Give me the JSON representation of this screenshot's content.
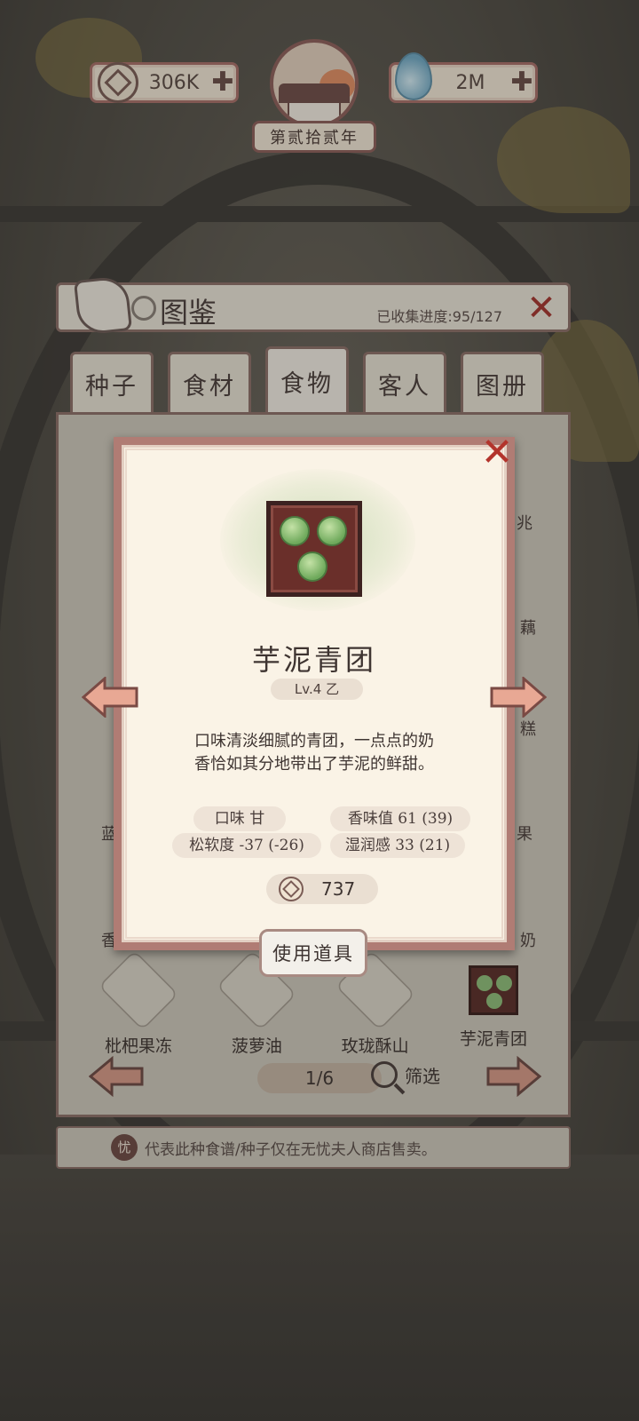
{
  "topbar": {
    "coins": "306K",
    "essence": "2M",
    "plus_symbol": "✚",
    "year_label": "第贰拾贰年"
  },
  "encyclopedia": {
    "title": "图鉴",
    "progress_label": "已收集进度:95/127",
    "close_symbol": "✕",
    "tabs": [
      {
        "label": "种子",
        "active": false
      },
      {
        "label": "食材",
        "active": false
      },
      {
        "label": "食物",
        "active": true
      },
      {
        "label": "客人",
        "active": false
      },
      {
        "label": "图册",
        "active": false
      }
    ],
    "partial_labels": {
      "left_1": "蓝",
      "left_2": "香",
      "right_1": "兆",
      "right_2": "藕",
      "right_3": "糕",
      "right_4": "果",
      "right_5": "奶"
    },
    "foods": [
      {
        "name": "枇杷果冻",
        "icon": "loquat-jelly-icon"
      },
      {
        "name": "菠萝油",
        "icon": "pineapple-bun-icon"
      },
      {
        "name": "玫珑酥山",
        "icon": "rose-crisp-icon"
      },
      {
        "name": "芋泥青团",
        "icon": "taro-qingtuan-icon"
      }
    ],
    "page": "1/6",
    "filter_label": "筛选",
    "note_badge": "忧",
    "note_text": "代表此种食谱/种子仅在无忧夫人商店售卖。"
  },
  "detail": {
    "close_symbol": "✕",
    "name": "芋泥青团",
    "level": "Lv.4  乙",
    "description_line1": "口味清淡细腻的青团，一点点的奶",
    "description_line2": "香恰如其分地带出了芋泥的鲜甜。",
    "stats": {
      "taste": "口味 甘",
      "aroma": "香味值 61 (39)",
      "softness": "松软度 -37 (-26)",
      "moisture": "湿润感 33 (21)"
    },
    "price": "737",
    "use_button": "使用道具"
  },
  "colors": {
    "accent": "#b07c74",
    "close_red": "#b3342c",
    "panel_bg": "#cfc9bd",
    "card_bg": "#faf3e6"
  }
}
